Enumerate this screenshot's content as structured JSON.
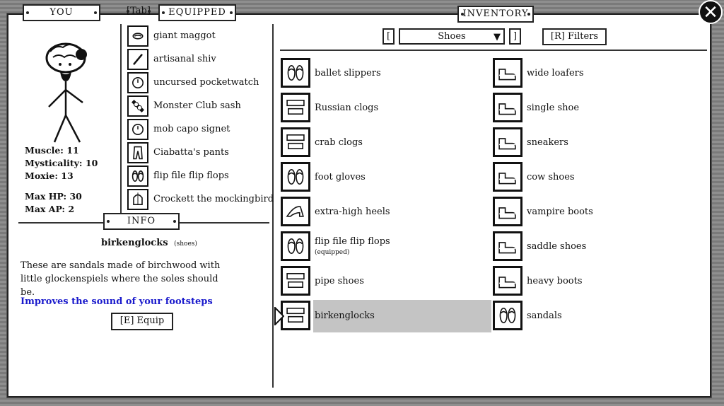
{
  "tabs": {
    "you": "YOU",
    "tab_key": "[Tab]",
    "equipped": "EQUIPPED",
    "inventory": "INVENTORY",
    "info": "INFO"
  },
  "stats": {
    "muscle": "Muscle: 11",
    "mysticality": "Mysticality: 10",
    "moxie": "Moxie: 13",
    "max_hp": "Max HP: 30",
    "max_ap": "Max AP: 2"
  },
  "equipped": [
    {
      "label": "giant maggot",
      "icon": "maggot-icon"
    },
    {
      "label": "artisanal shiv",
      "icon": "shiv-icon"
    },
    {
      "label": "uncursed pocketwatch",
      "icon": "pocketwatch-icon"
    },
    {
      "label": "Monster Club sash",
      "icon": "sash-icon"
    },
    {
      "label": "mob capo signet",
      "icon": "signet-ring-icon"
    },
    {
      "label": "Ciabatta's pants",
      "icon": "pants-icon"
    },
    {
      "label": "flip file flip flops",
      "icon": "flip-flops-icon"
    },
    {
      "label": "Crockett the mockingbird",
      "icon": "birdcage-icon"
    }
  ],
  "info": {
    "item_name": "birkenglocks",
    "item_type": "(shoes)",
    "description": "These are sandals made of birchwood with little glockenspiels where the soles should be.",
    "effect": "Improves the sound of your footsteps",
    "effect_color": "#1a1acc",
    "equip_button": "[E]  Equip"
  },
  "filter": {
    "bracket_left": "[",
    "bracket_right": "]",
    "category": "Shoes",
    "filters_button": "[R]  Filters"
  },
  "inventory": [
    {
      "label": "ballet slippers",
      "icon": "ballet-slippers-icon"
    },
    {
      "label": "Russian clogs",
      "icon": "clogs-icon"
    },
    {
      "label": "crab clogs",
      "icon": "crab-clogs-icon"
    },
    {
      "label": "foot gloves",
      "icon": "foot-gloves-icon"
    },
    {
      "label": "extra-high heels",
      "icon": "high-heels-icon"
    },
    {
      "label": "flip file flip flops",
      "sub": "(equipped)",
      "icon": "flip-flops-icon"
    },
    {
      "label": "pipe shoes",
      "icon": "pipe-shoes-icon"
    },
    {
      "label": "birkenglocks",
      "icon": "birkenglocks-icon",
      "selected": true
    },
    {
      "label": "wide loafers",
      "icon": "loafers-icon"
    },
    {
      "label": "single shoe",
      "icon": "single-shoe-icon"
    },
    {
      "label": "sneakers",
      "icon": "sneakers-icon"
    },
    {
      "label": "cow shoes",
      "icon": "cow-shoes-icon"
    },
    {
      "label": "vampire boots",
      "icon": "vampire-boots-icon"
    },
    {
      "label": "saddle shoes",
      "icon": "saddle-shoes-icon"
    },
    {
      "label": "heavy boots",
      "icon": "heavy-boots-icon"
    },
    {
      "label": "sandals",
      "icon": "sandals-icon"
    }
  ]
}
